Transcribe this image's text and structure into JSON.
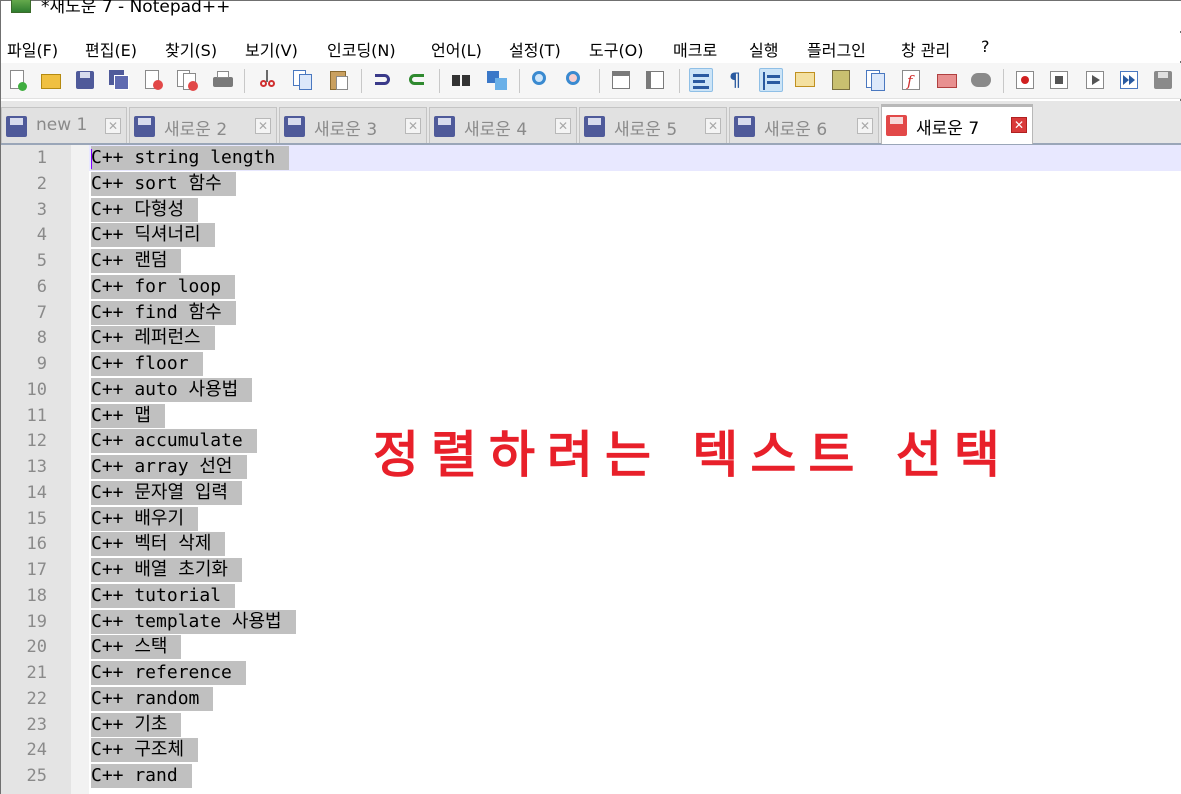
{
  "window": {
    "title": "*새노운 7 - Notepad++"
  },
  "menu": [
    "파일(F)",
    "편집(E)",
    "찾기(S)",
    "보기(V)",
    "인코딩(N)",
    "언어(L)",
    "설정(T)",
    "도구(O)",
    "매크로",
    "실행",
    "플러그인",
    "창 관리",
    "?"
  ],
  "toolbar_icons": [
    "new-file-icon",
    "open-file-icon",
    "save-icon",
    "save-all-icon",
    "close-icon",
    "close-all-icon",
    "print-icon",
    "cut-icon",
    "copy-icon",
    "paste-icon",
    "undo-icon",
    "redo-icon",
    "find-icon",
    "replace-icon",
    "zoom-in-icon",
    "zoom-out-icon",
    "sync-vertical-icon",
    "sync-horizontal-icon",
    "word-wrap-icon",
    "show-all-chars-icon",
    "indent-guide-icon",
    "user-lang-icon",
    "doc-map-icon",
    "doc-list-icon",
    "function-list-icon",
    "folder-workspace-icon",
    "monitor-icon",
    "record-macro-icon",
    "stop-macro-icon",
    "play-macro-icon",
    "run-macro-multiple-icon",
    "save-macro-icon"
  ],
  "tabs": [
    {
      "label": "new 1",
      "active": false
    },
    {
      "label": "새로운 2",
      "active": false
    },
    {
      "label": "새로운 3",
      "active": false
    },
    {
      "label": "새로운 4",
      "active": false
    },
    {
      "label": "새로운 5",
      "active": false
    },
    {
      "label": "새로운 6",
      "active": false
    },
    {
      "label": "새로운 7",
      "active": true
    }
  ],
  "editor": {
    "lines": [
      "C++ string length",
      "C++ sort 함수",
      "C++ 다형성",
      "C++ 딕셔너리",
      "C++ 랜덤",
      "C++ for loop",
      "C++ find 함수",
      "C++ 레퍼런스",
      "C++ floor",
      "C++ auto 사용법",
      "C++ 맵",
      "C++ accumulate",
      "C++ array 선언",
      "C++ 문자열 입력",
      "C++ 배우기",
      "C++ 벡터 삭제",
      "C++ 배열 초기화",
      "C++ tutorial",
      "C++ template 사용법",
      "C++ 스택",
      "C++ reference",
      "C++ random",
      "C++ 기초",
      "C++ 구조체",
      "C++ rand"
    ]
  },
  "annotation": "정렬하려는 텍스트 선택",
  "colors": {
    "annotation": "#e8202a",
    "selection": "#c0c0c0",
    "active_tab_accent": "#f5a040"
  }
}
